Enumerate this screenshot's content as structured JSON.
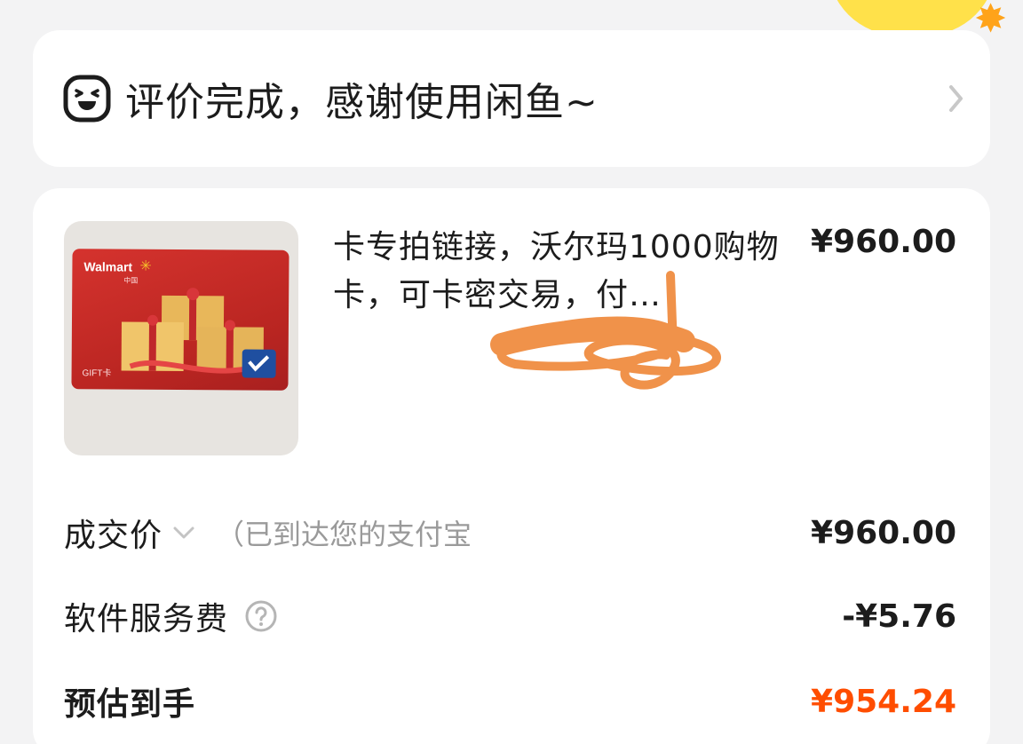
{
  "review_banner": {
    "text": "评价完成，感谢使用闲鱼~",
    "face_icon": "laughing-face-icon",
    "chevron_icon": "chevron-right-icon"
  },
  "order": {
    "product": {
      "thumbnail": {
        "brand": "Walmart",
        "brand_sub": "中国",
        "label": "GIFT卡"
      },
      "title": "卡专拍链接，沃尔玛1000购物卡，可卡密交易，付…",
      "price": "¥960.00"
    },
    "deal_price": {
      "label": "成交价",
      "note": "（已到达您的支付宝",
      "value": "¥960.00"
    },
    "service_fee": {
      "label": "软件服务费",
      "value": "-¥5.76",
      "help_icon": "question-circle-icon"
    },
    "estimated_receipt": {
      "label": "预估到手",
      "value": "¥954.24"
    }
  },
  "colors": {
    "accent": "#ff4d00",
    "background": "#f3f3f4",
    "card": "#ffffff",
    "scribble": "#f0924a"
  }
}
